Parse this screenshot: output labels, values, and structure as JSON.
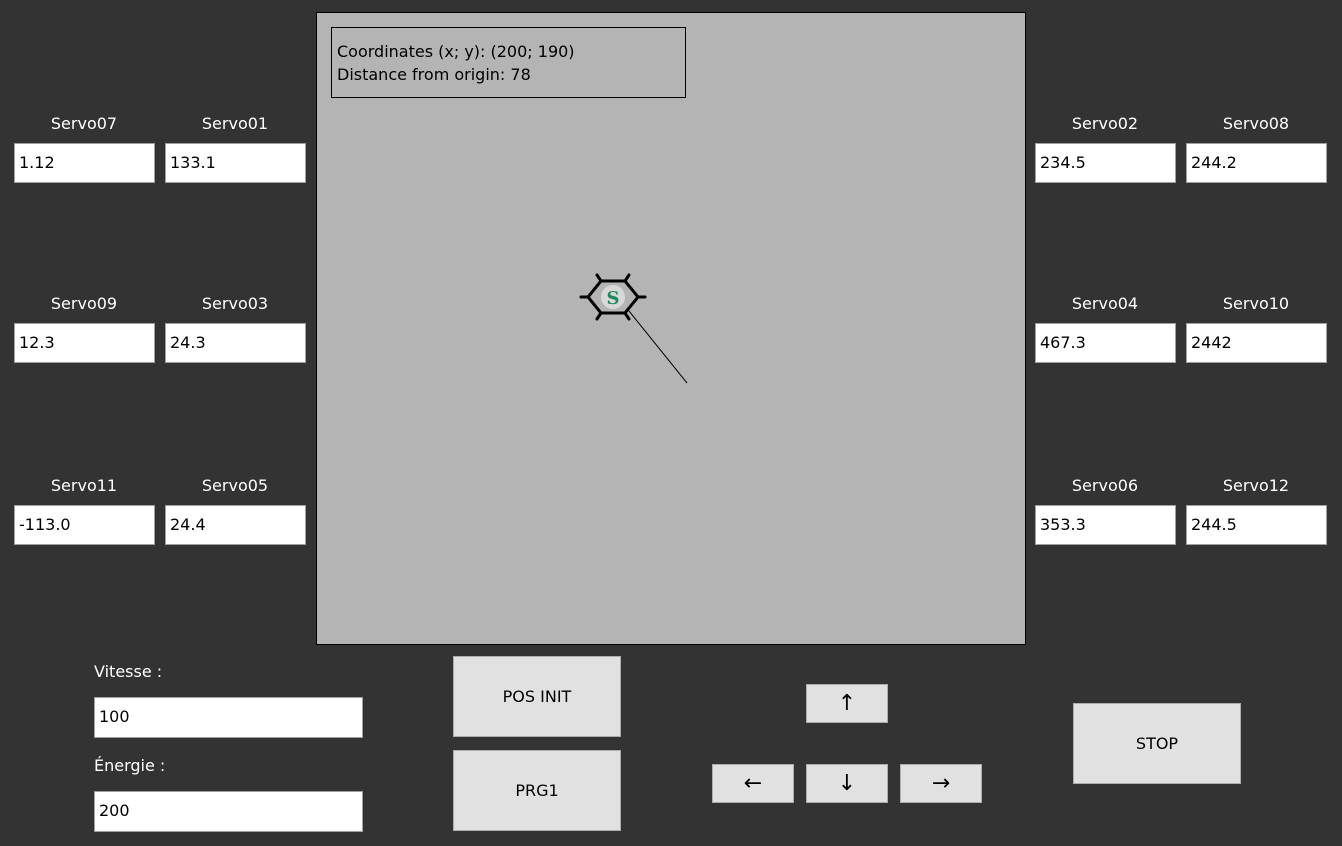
{
  "servos": {
    "s07": {
      "label": "Servo07",
      "value": "1.12"
    },
    "s01": {
      "label": "Servo01",
      "value": "133.1"
    },
    "s02": {
      "label": "Servo02",
      "value": "234.5"
    },
    "s08": {
      "label": "Servo08",
      "value": "244.2"
    },
    "s09": {
      "label": "Servo09",
      "value": "12.3"
    },
    "s03": {
      "label": "Servo03",
      "value": "24.3"
    },
    "s04": {
      "label": "Servo04",
      "value": "467.3"
    },
    "s10": {
      "label": "Servo10",
      "value": "2442"
    },
    "s11": {
      "label": "Servo11",
      "value": "-113.0"
    },
    "s05": {
      "label": "Servo05",
      "value": "24.4"
    },
    "s06": {
      "label": "Servo06",
      "value": "353.3"
    },
    "s12": {
      "label": "Servo12",
      "value": "244.5"
    }
  },
  "canvas": {
    "coordinates_text": "Coordinates (x; y): (200; 190)",
    "distance_text": "Distance from origin: 78",
    "robot_icon": "hexapod-robot-icon",
    "robot_logo_letter": "S",
    "colors": {
      "background": "#b4b4b4",
      "robot_logo": "#1a8a5a"
    }
  },
  "controls": {
    "vitesse_label": "Vitesse :",
    "vitesse_value": "100",
    "energie_label": "Énergie :",
    "energie_value": "200",
    "pos_init_label": "POS INIT",
    "prg1_label": "PRG1",
    "up_label": "↑",
    "down_label": "↓",
    "left_label": "←",
    "right_label": "→",
    "stop_label": "STOP"
  },
  "colors": {
    "window_bg": "#333333",
    "button_bg": "#e1e1e1"
  }
}
